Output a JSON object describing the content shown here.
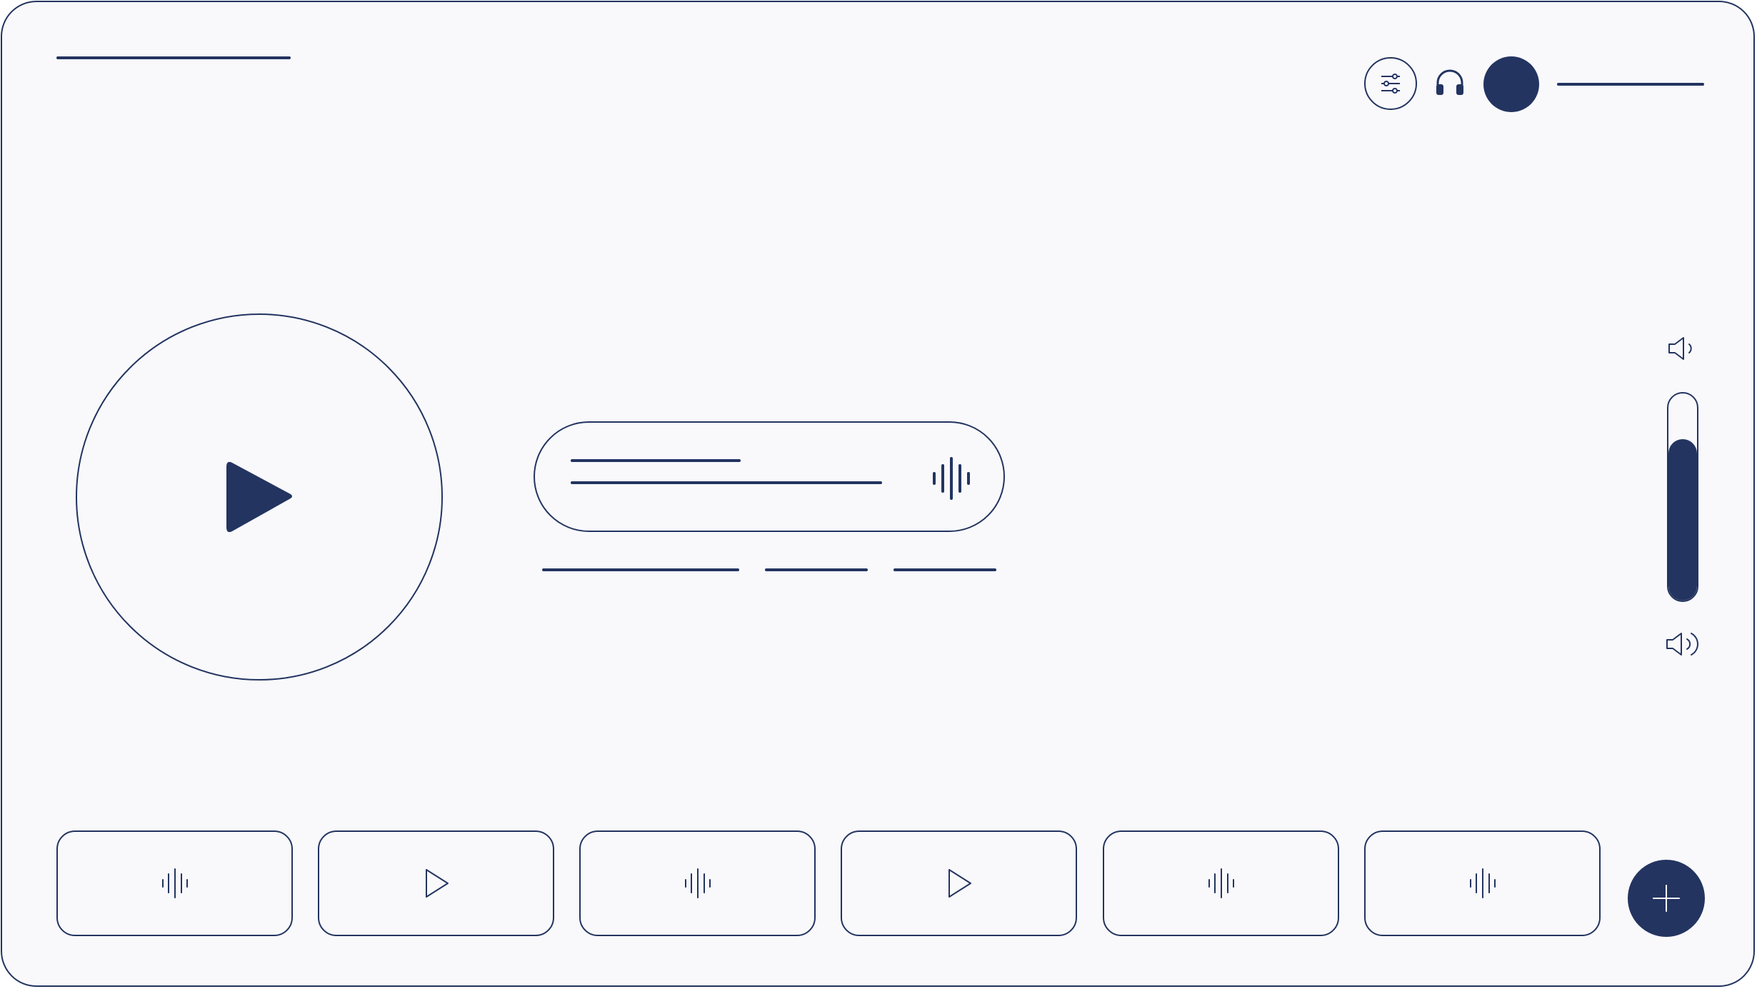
{
  "app": {
    "title": "",
    "user_name": ""
  },
  "header": {
    "settings_icon": "sliders-icon",
    "output_icon": "headphones-icon",
    "avatar": ""
  },
  "player": {
    "state": "paused",
    "play_icon": "play-icon",
    "track": {
      "title": "",
      "artist": "",
      "visualizer_icon": "waveform-icon"
    },
    "meta": [
      "",
      "",
      ""
    ]
  },
  "volume": {
    "level": 0.78,
    "low_icon": "volume-low-icon",
    "high_icon": "volume-high-icon"
  },
  "playlist": {
    "tiles": [
      {
        "icon": "waveform-icon"
      },
      {
        "icon": "play-icon"
      },
      {
        "icon": "waveform-icon"
      },
      {
        "icon": "play-icon"
      },
      {
        "icon": "waveform-icon"
      },
      {
        "icon": "waveform-icon"
      }
    ],
    "add_icon": "plus-icon"
  },
  "colors": {
    "accent": "#233460",
    "background": "#f9f9fc",
    "border": "#233460"
  }
}
